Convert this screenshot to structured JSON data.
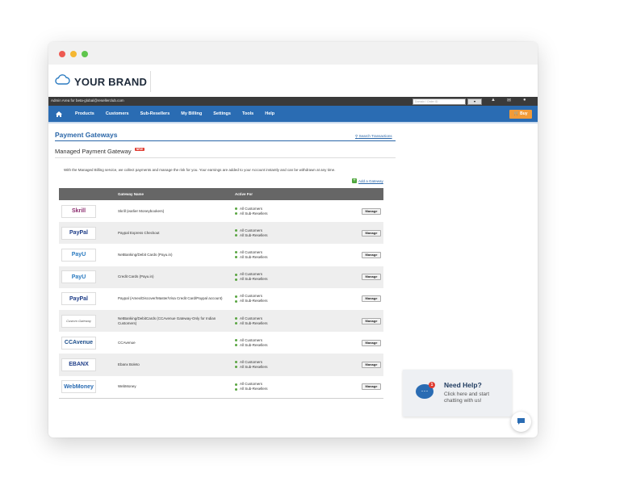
{
  "brand": {
    "name": "YOUR BRAND"
  },
  "admin_bar": {
    "text": "Admin Area for beta-global@resellerclub.com",
    "search_placeholder": "Domain / Order ID",
    "search_button": "▾"
  },
  "nav": {
    "items": [
      "Products",
      "Customers",
      "Sub-Resellers",
      "My Billing",
      "Settings",
      "Tools",
      "Help"
    ],
    "buy_label": "Buy"
  },
  "page": {
    "title": "Payment Gateways",
    "search_link": "Search Transactions",
    "section_title": "Managed Payment Gateway",
    "new_badge": "NEW",
    "description": "With the Managed Billing service, we collect payments and manage the risk for you. Your earnings are added to your Account instantly and can be withdrawn at any time.",
    "add_gateway": "Add a Gateway"
  },
  "table": {
    "headers": [
      "Gateway Name",
      "Active For"
    ],
    "manage_label": "Manage",
    "active_for": [
      "All Customers",
      "All Sub-Resellers"
    ],
    "rows": [
      {
        "logo": "Skrill",
        "logo_color": "#8b2c6e",
        "name": "Skrill (earlier Moneybookers)"
      },
      {
        "logo": "PayPal",
        "logo_color": "#1d3c87",
        "name": "Paypal Express Checkout"
      },
      {
        "logo": "PayU",
        "logo_color": "#2a7ac0",
        "name": "NetBanking/Debit Cards (Payu.in)"
      },
      {
        "logo": "PayU",
        "logo_color": "#2a7ac0",
        "name": "Credit Cards (Payu.in)"
      },
      {
        "logo": "PayPal",
        "logo_color": "#1d3c87",
        "name": "Paypal (Amex/Discover/Master/Visa Credit Card/Paypal account)"
      },
      {
        "logo": "Custom Gateway",
        "logo_color": "#555555",
        "name": "NetBanking/DebitCards (CCAvenue Gateway-Only for Indian Customers)"
      },
      {
        "logo": "CCAvenue",
        "logo_color": "#1d4f8c",
        "name": "CCAvenue"
      },
      {
        "logo": "EBANX",
        "logo_color": "#1d3c87",
        "name": "Ebanx Boleto"
      },
      {
        "logo": "WebMoney",
        "logo_color": "#2a6cb3",
        "name": "WebMoney"
      }
    ]
  },
  "chat": {
    "badge": "1",
    "title": "Need Help?",
    "subtitle": "Click here and start chatting with us!"
  },
  "colors": {
    "nav": "#2a6cb3",
    "accent_orange": "#f29b38",
    "title_blue": "#2a66a8",
    "status_green": "#5aa542"
  }
}
